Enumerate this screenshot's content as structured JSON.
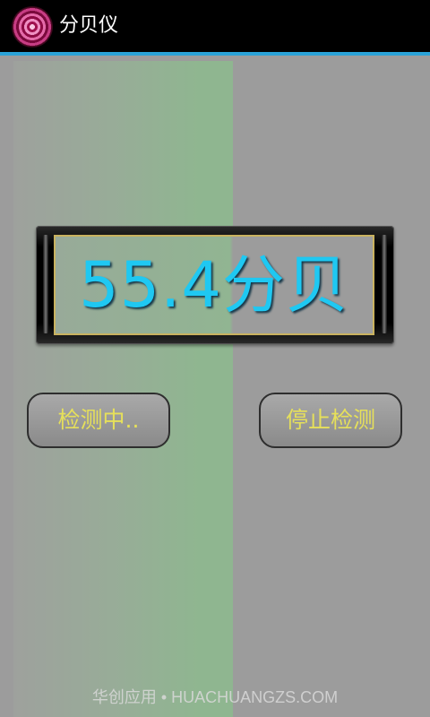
{
  "app": {
    "title": "分贝仪",
    "icon": "target-logo-icon"
  },
  "meter": {
    "reading": "55.4分贝",
    "reading_color": "#1fc8f2"
  },
  "buttons": {
    "detecting_label": "检测中..",
    "stop_label": "停止检测",
    "label_color": "#e6e05a"
  },
  "watermark": {
    "text": "华创应用 • HUACHUANGZS.COM"
  },
  "colors": {
    "title_bar": "#000000",
    "accent_line": "#2aa3d8",
    "background": "#9c9c9c",
    "level_panel": "#8fb690"
  }
}
